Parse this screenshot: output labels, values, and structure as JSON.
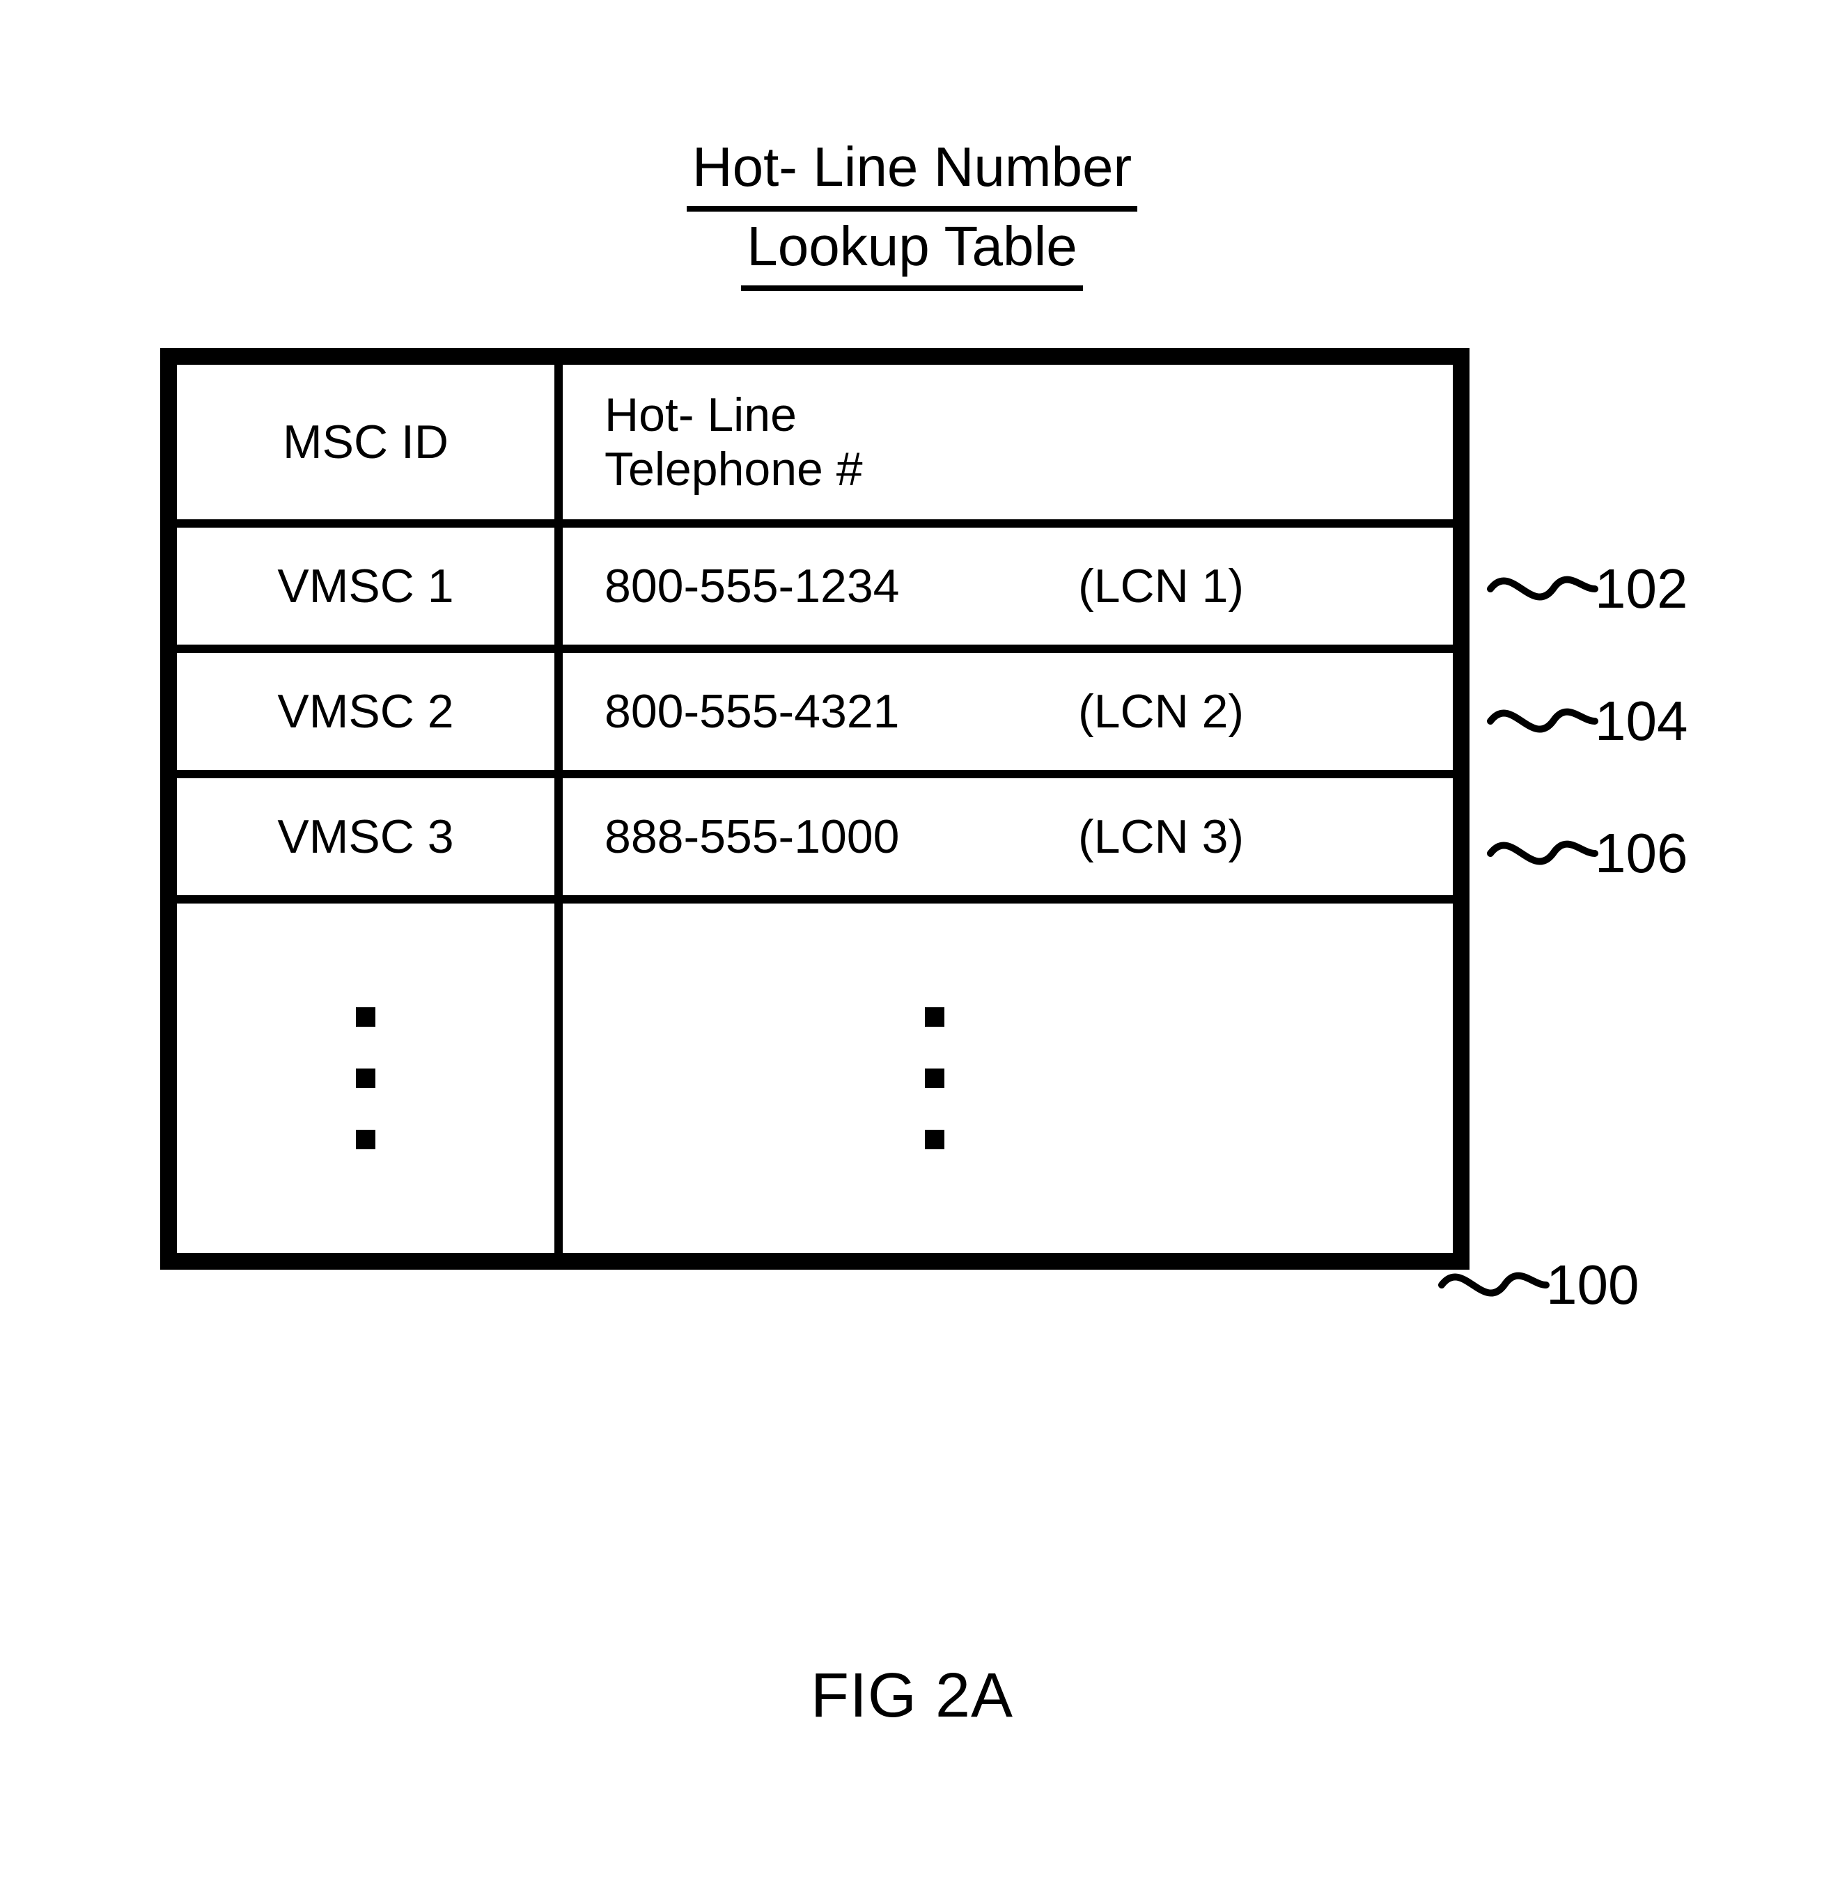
{
  "title": {
    "line1": "Hot- Line Number",
    "line2": "Lookup Table"
  },
  "headers": {
    "msc_id": "MSC ID",
    "hotline": "Hot- Line\nTelephone #"
  },
  "rows": [
    {
      "msc_id": "VMSC 1",
      "phone": "800-555-1234",
      "lcn": "(LCN 1)"
    },
    {
      "msc_id": "VMSC 2",
      "phone": "800-555-4321",
      "lcn": "(LCN 2)"
    },
    {
      "msc_id": "VMSC 3",
      "phone": "888-555-1000",
      "lcn": "(LCN 3)"
    }
  ],
  "callouts": {
    "r1": "102",
    "r2": "104",
    "r3": "106",
    "table": "100"
  },
  "figure_caption": "FIG 2A"
}
